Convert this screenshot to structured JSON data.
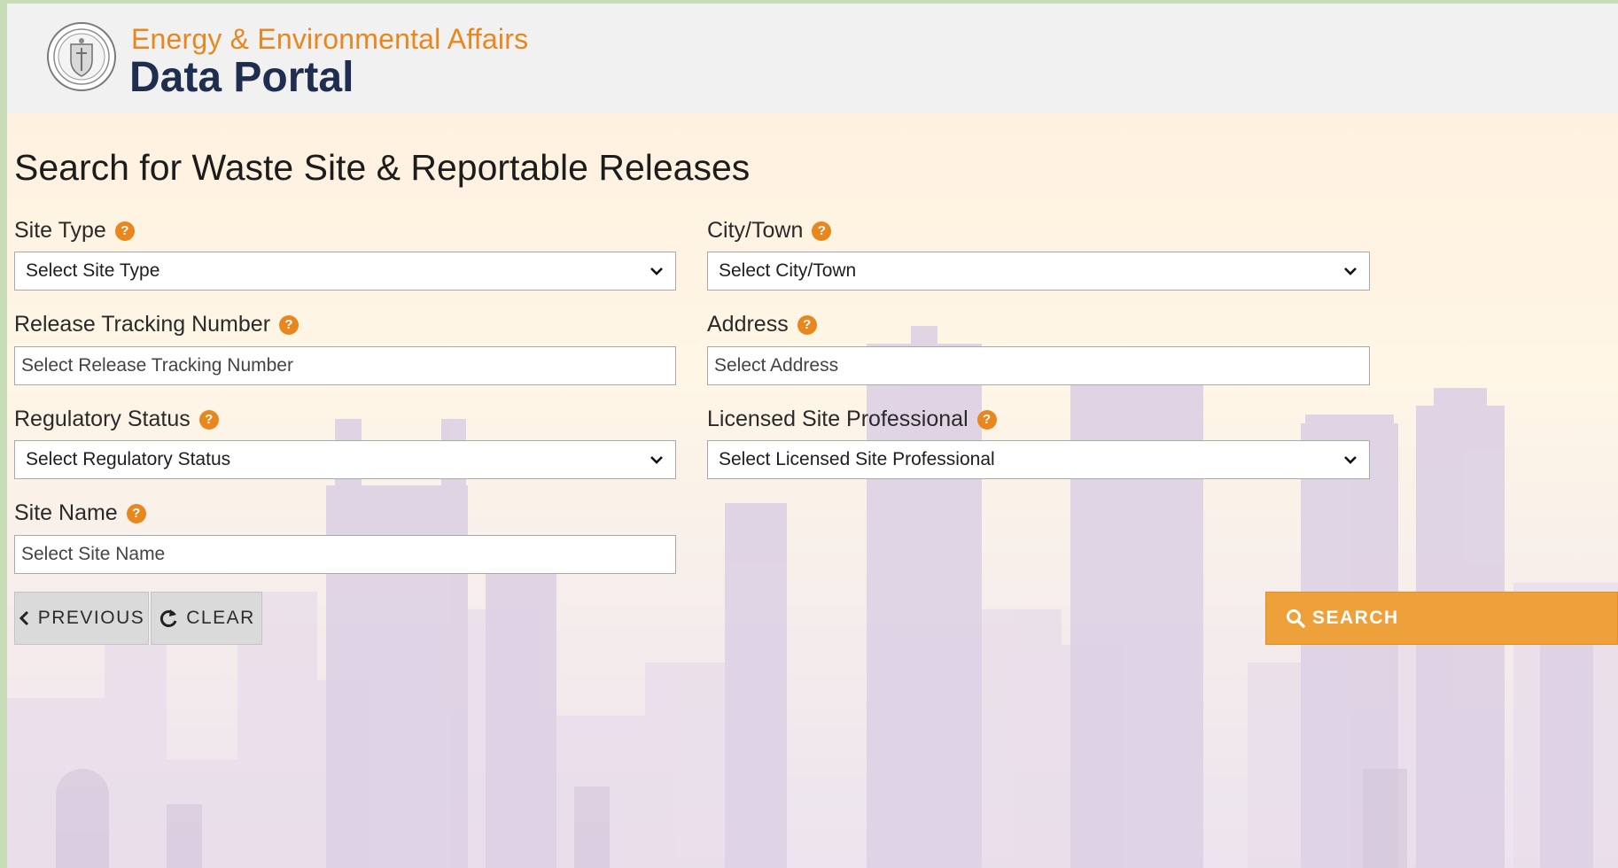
{
  "header": {
    "subtitle": "Energy & Environmental Affairs",
    "title": "Data Portal"
  },
  "page": {
    "title": "Search for Waste Site & Reportable Releases"
  },
  "fields": {
    "site_type": {
      "label": "Site Type",
      "value": "Select Site Type"
    },
    "city_town": {
      "label": "City/Town",
      "value": "Select City/Town"
    },
    "rtn": {
      "label": "Release Tracking Number",
      "placeholder": "Select Release Tracking Number"
    },
    "address": {
      "label": "Address",
      "placeholder": "Select Address"
    },
    "regulatory_status": {
      "label": "Regulatory Status",
      "value": "Select Regulatory Status"
    },
    "lsp": {
      "label": "Licensed Site Professional",
      "value": "Select Licensed Site Professional"
    },
    "site_name": {
      "label": "Site Name",
      "placeholder": "Select Site Name"
    }
  },
  "help_glyph": "?",
  "buttons": {
    "previous": "PREVIOUS",
    "clear": "CLEAR",
    "search": "SEARCH"
  },
  "colors": {
    "accent": "#e8871e",
    "brand_navy": "#1f2d4e",
    "search_button": "#eea13a"
  },
  "icons": {
    "seal": "massachusetts-seal-icon",
    "help": "help-circle-icon",
    "select": "chevron-down-icon",
    "previous": "chevron-left-icon",
    "clear": "refresh-icon",
    "search": "magnifier-icon"
  }
}
